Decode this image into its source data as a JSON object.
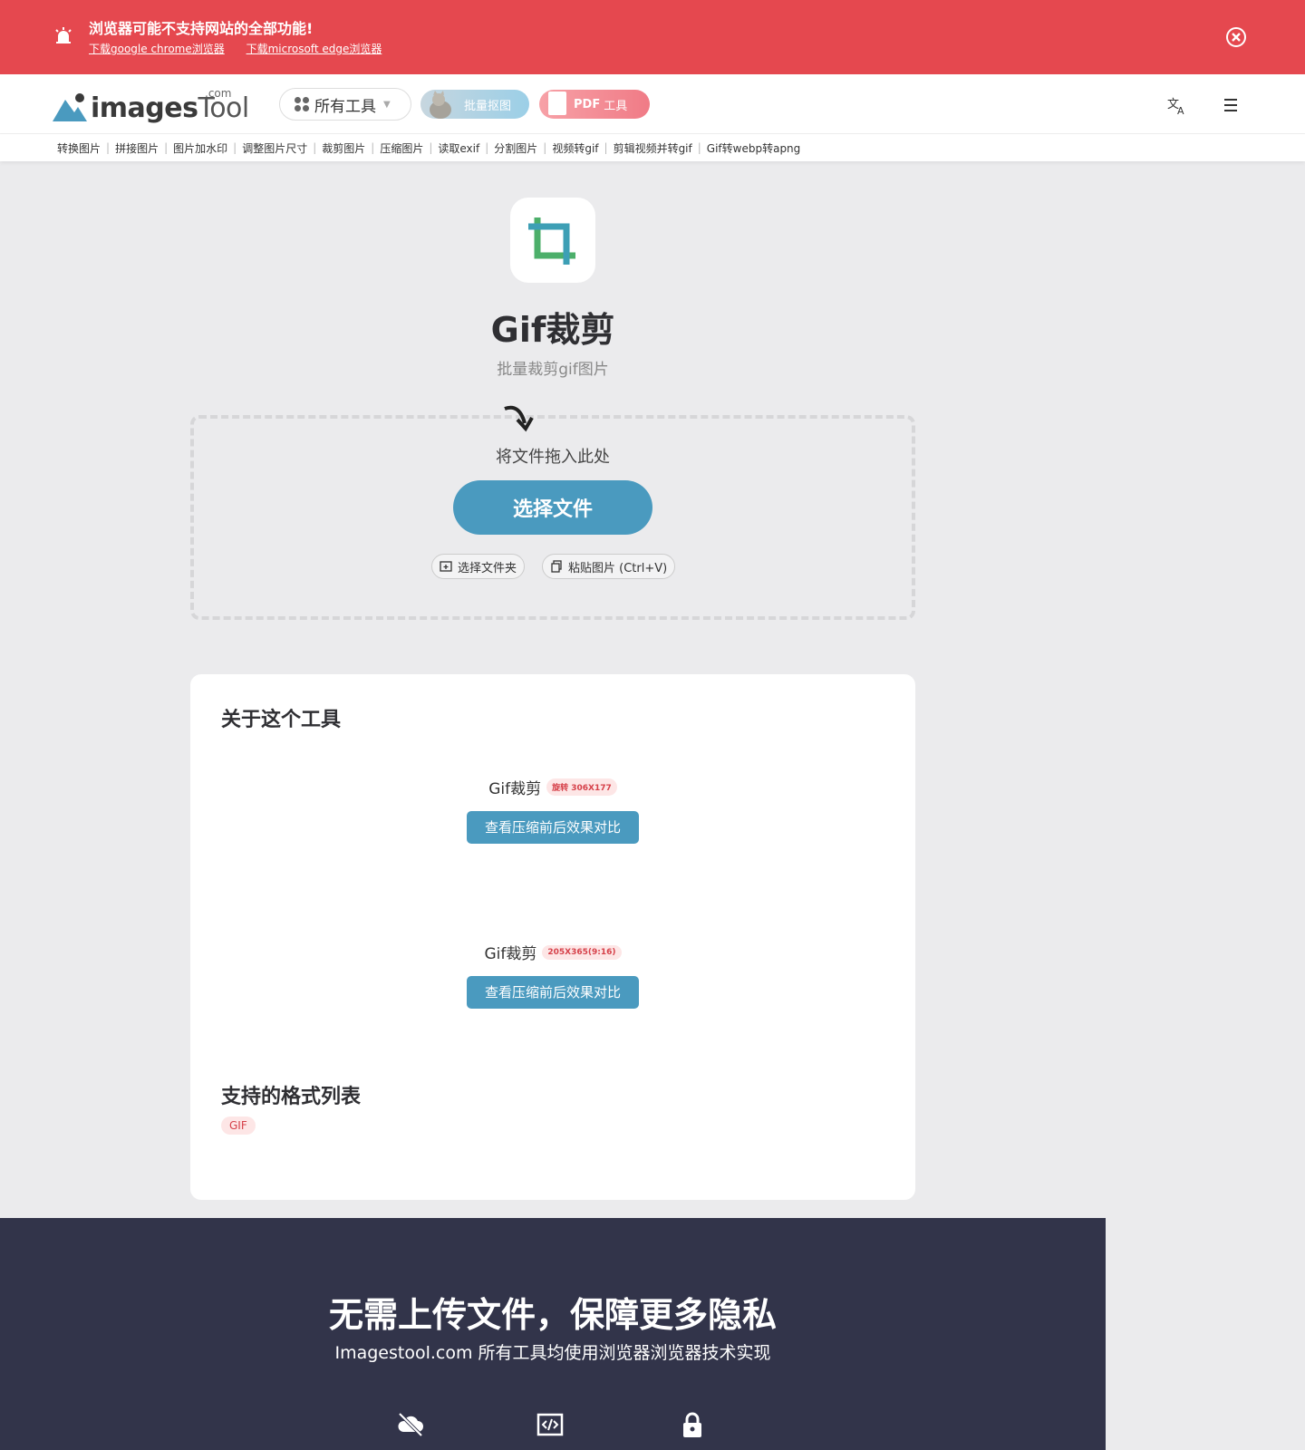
{
  "banner": {
    "title": "浏览器可能不支持网站的全部功能!",
    "links": [
      "下载google chrome浏览器",
      "下载microsoft edge浏览器"
    ]
  },
  "header": {
    "logo": {
      "name": "images",
      "name2": "Tool",
      "suffix": ".com"
    },
    "all_tools": "所有工具",
    "pill_cutout": "批量抠图",
    "pill_pdf_bold": "PDF",
    "pill_pdf_text": "工具"
  },
  "quick_links": [
    "转换图片",
    "拼接图片",
    "图片加水印",
    "调整图片尺寸",
    "裁剪图片",
    "压缩图片",
    "读取exif",
    "分割图片",
    "视频转gif",
    "剪辑视频并转gif",
    "Gif转webp转apng"
  ],
  "hero": {
    "title": "Gif裁剪",
    "subtitle": "批量裁剪gif图片"
  },
  "dropzone": {
    "hint": "将文件拖入此处",
    "choose": "选择文件",
    "folder": "选择文件夹",
    "paste": "粘贴图片 (Ctrl+V)"
  },
  "about": {
    "heading": "关于这个工具",
    "demos": [
      {
        "name": "Gif裁剪",
        "badge": "旋转 306X177",
        "compare": "查看压缩前后效果对比"
      },
      {
        "name": "Gif裁剪",
        "badge": "205X365(9:16)",
        "compare": "查看压缩前后效果对比"
      }
    ],
    "formats_heading": "支持的格式列表",
    "formats": [
      "GIF"
    ]
  },
  "footer": {
    "title": "无需上传文件，保障更多隐私",
    "subtitle": "Imagestool.com 所有工具均使用浏览器浏览器技术实现",
    "icons": [
      "cloud-off-icon",
      "code-icon",
      "lock-icon"
    ]
  },
  "colors": {
    "banner": "#e5484f",
    "primary": "#4a9abf",
    "footer": "#32344a",
    "badge": "#d6414a"
  }
}
